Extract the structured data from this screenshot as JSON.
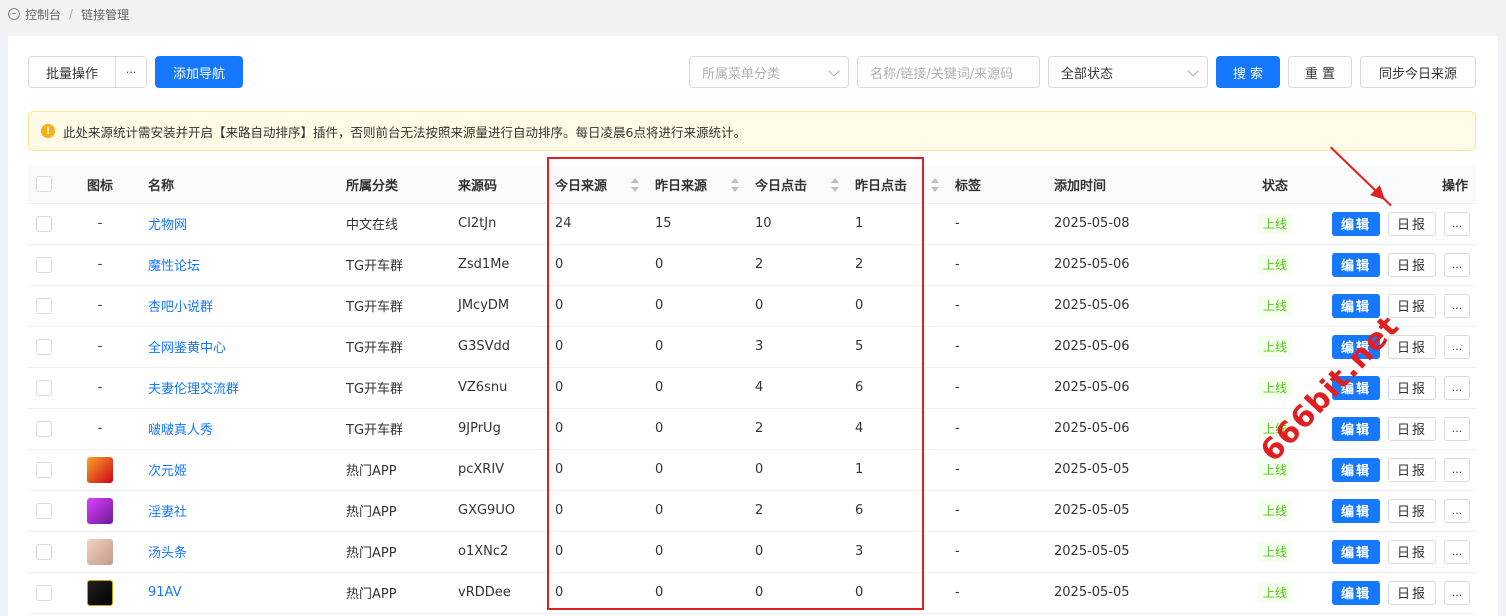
{
  "breadcrumb": {
    "home": "控制台",
    "separator": "/",
    "current": "链接管理"
  },
  "toolbar": {
    "batch_label": "批量操作",
    "more_label": "···",
    "add_nav_label": "添加导航",
    "category_placeholder": "所属菜单分类",
    "keyword_placeholder": "名称/链接/关键词/来源码",
    "status_value": "全部状态",
    "search_label": "搜 索",
    "reset_label": "重 置",
    "sync_label": "同步今日来源"
  },
  "notice": {
    "text": "此处来源统计需安装并开启【来路自动排序】插件，否则前台无法按照来源量进行自动排序。每日凌晨6点将进行来源统计。"
  },
  "table": {
    "headers": [
      "图标",
      "名称",
      "所属分类",
      "来源码",
      "今日来源",
      "昨日来源",
      "今日点击",
      "昨日点击",
      "标签",
      "添加时间",
      "状态",
      "操作"
    ],
    "ops": {
      "edit": "编辑",
      "report": "日报",
      "more": "..."
    },
    "rows": [
      {
        "icon": "-",
        "name": "尤物网",
        "category": "中文在线",
        "code": "CI2tJn",
        "today_src": "24",
        "yest_src": "15",
        "today_click": "10",
        "yest_click": "1",
        "tag": "-",
        "date": "2025-05-08",
        "status": "上线"
      },
      {
        "icon": "-",
        "name": "魔性论坛",
        "category": "TG开车群",
        "code": "Zsd1Me",
        "today_src": "0",
        "yest_src": "0",
        "today_click": "2",
        "yest_click": "2",
        "tag": "-",
        "date": "2025-05-06",
        "status": "上线"
      },
      {
        "icon": "-",
        "name": "杏吧小说群",
        "category": "TG开车群",
        "code": "JMcyDM",
        "today_src": "0",
        "yest_src": "0",
        "today_click": "0",
        "yest_click": "0",
        "tag": "-",
        "date": "2025-05-06",
        "status": "上线"
      },
      {
        "icon": "-",
        "name": "全网鉴黄中心",
        "category": "TG开车群",
        "code": "G3SVdd",
        "today_src": "0",
        "yest_src": "0",
        "today_click": "3",
        "yest_click": "5",
        "tag": "-",
        "date": "2025-05-06",
        "status": "上线"
      },
      {
        "icon": "-",
        "name": "夫妻伦理交流群",
        "category": "TG开车群",
        "code": "VZ6snu",
        "today_src": "0",
        "yest_src": "0",
        "today_click": "4",
        "yest_click": "6",
        "tag": "-",
        "date": "2025-05-06",
        "status": "上线"
      },
      {
        "icon": "-",
        "name": "啵啵真人秀",
        "category": "TG开车群",
        "code": "9JPrUg",
        "today_src": "0",
        "yest_src": "0",
        "today_click": "2",
        "yest_click": "4",
        "tag": "-",
        "date": "2025-05-06",
        "status": "上线"
      },
      {
        "icon": "",
        "name": "次元姬",
        "category": "热门APP",
        "code": "pcXRIV",
        "today_src": "0",
        "yest_src": "0",
        "today_click": "0",
        "yest_click": "1",
        "tag": "-",
        "date": "2025-05-05",
        "status": "上线"
      },
      {
        "icon": "",
        "name": "淫妻社",
        "category": "热门APP",
        "code": "GXG9UO",
        "today_src": "0",
        "yest_src": "0",
        "today_click": "2",
        "yest_click": "6",
        "tag": "-",
        "date": "2025-05-05",
        "status": "上线"
      },
      {
        "icon": "",
        "name": "汤头条",
        "category": "热门APP",
        "code": "o1XNc2",
        "today_src": "0",
        "yest_src": "0",
        "today_click": "0",
        "yest_click": "3",
        "tag": "-",
        "date": "2025-05-05",
        "status": "上线"
      },
      {
        "icon": "",
        "name": "91AV",
        "category": "热门APP",
        "code": "vRDDee",
        "today_src": "0",
        "yest_src": "0",
        "today_click": "0",
        "yest_click": "0",
        "tag": "-",
        "date": "2025-05-05",
        "status": "上线"
      }
    ]
  },
  "watermark": "666bit.net",
  "colors": {
    "primary": "#1677ff",
    "online": "#52c41a",
    "annotation": "#e02020",
    "notice_bg": "#fffbe6"
  }
}
